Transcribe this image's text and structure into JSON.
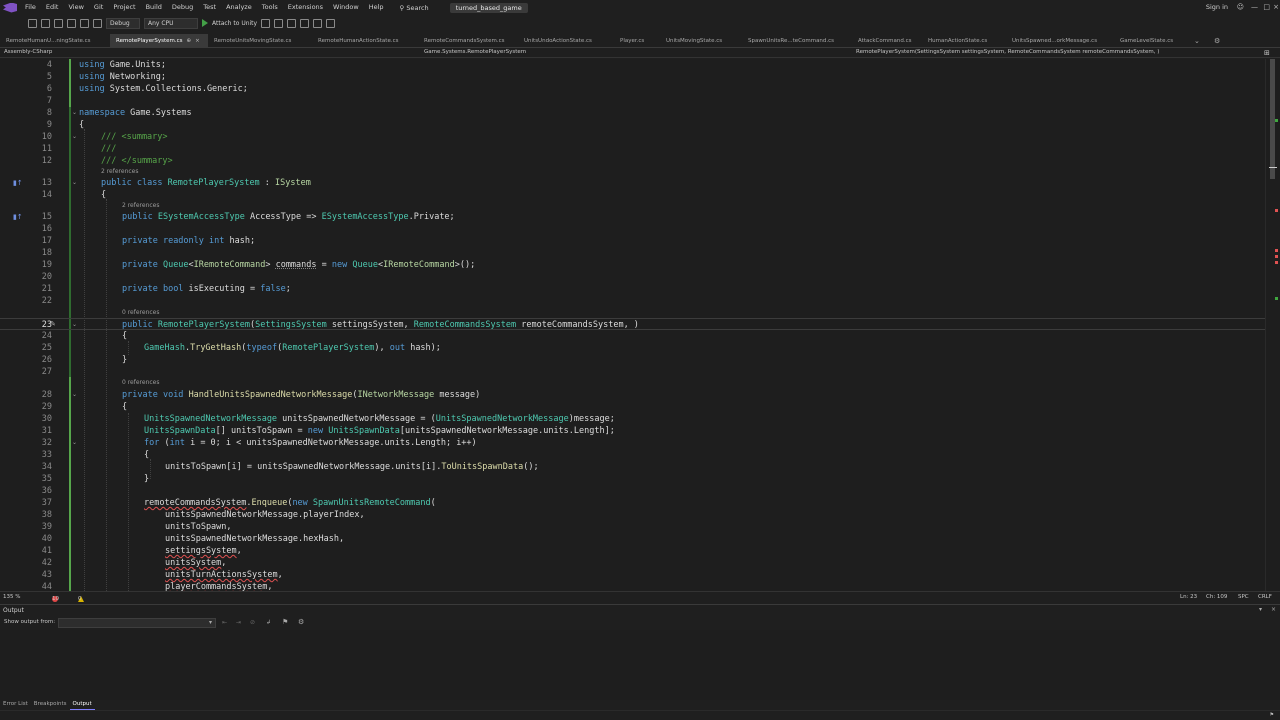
{
  "menu": [
    "File",
    "Edit",
    "View",
    "Git",
    "Project",
    "Build",
    "Debug",
    "Test",
    "Analyze",
    "Tools",
    "Extensions",
    "Window",
    "Help"
  ],
  "search_label": "Search",
  "solution_name": "turned_based_game",
  "signin": "Sign in",
  "toolbar": {
    "config": "Debug",
    "platform": "Any CPU",
    "attach": "Attach to Unity"
  },
  "tabs": [
    {
      "label": "RemoteHumanU...ningState.cs",
      "active": false
    },
    {
      "label": "RemotePlayerSystem.cs",
      "active": true,
      "pin": "⊕",
      "close": "×"
    },
    {
      "label": "RemoteUnitsMovingState.cs",
      "active": false
    },
    {
      "label": "RemoteHumanActionState.cs",
      "active": false
    },
    {
      "label": "RemoteCommandsSystem.cs",
      "active": false
    },
    {
      "label": "UnitsUndoActionState.cs",
      "active": false
    },
    {
      "label": "Player.cs",
      "active": false
    },
    {
      "label": "UnitsMovingState.cs",
      "active": false
    },
    {
      "label": "SpawnUnitsRe...teCommand.cs",
      "active": false
    },
    {
      "label": "AttackCommand.cs",
      "active": false
    },
    {
      "label": "HumanActionState.cs",
      "active": false
    },
    {
      "label": "UnitsSpawned...orkMessage.cs",
      "active": false
    },
    {
      "label": "GameLevelState.cs",
      "active": false
    }
  ],
  "nav": {
    "project": "Assembly-CSharp",
    "type": "Game.Systems.RemotePlayerSystem",
    "member": "RemotePlayerSystem(SettingsSystem settingsSystem, RemoteCommandsSystem remoteCommandsSystem, )"
  },
  "codelens": {
    "refs2": "2 references",
    "refs0": "0 references"
  },
  "line_numbers": [
    "4",
    "5",
    "6",
    "7",
    "8",
    "9",
    "10",
    "11",
    "12",
    "13",
    "14",
    "15",
    "16",
    "17",
    "18",
    "19",
    "20",
    "21",
    "22",
    "23",
    "24",
    "25",
    "26",
    "27",
    "28",
    "29",
    "30",
    "31",
    "32",
    "33",
    "34",
    "35",
    "36",
    "37",
    "38",
    "39",
    "40",
    "41",
    "42",
    "43",
    "44"
  ],
  "status": {
    "zoom": "135 %",
    "errors": "10",
    "warnings": "0",
    "position": "Ln: 23",
    "column": "Ch: 109",
    "spc": "SPC",
    "eol": "CRLF"
  },
  "output": {
    "title": "Output",
    "show_from": "Show output from:",
    "source": ""
  },
  "bottom_tabs": [
    "Error List",
    "Breakpoints",
    "Output"
  ]
}
